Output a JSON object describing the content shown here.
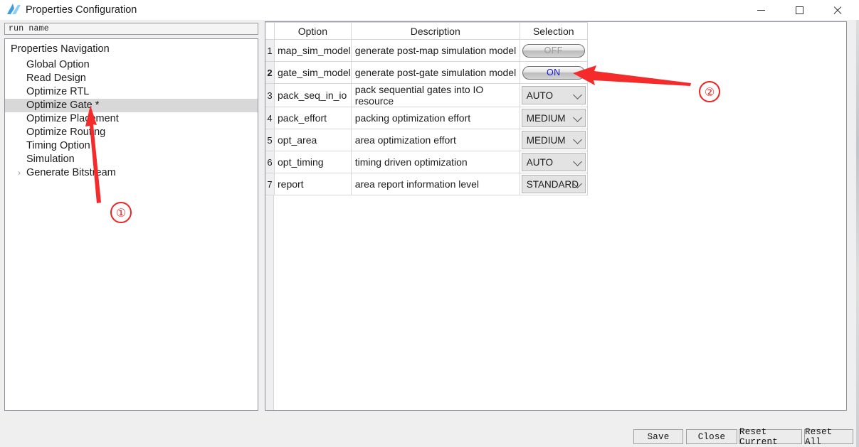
{
  "window": {
    "title": "Properties Configuration",
    "icon": "app-logo-icon",
    "minimize_label": "–",
    "maximize_label": "□",
    "close_label": "✕"
  },
  "run_name_field": {
    "value": "run name",
    "placeholder": "run name"
  },
  "navigation": {
    "root_label": "Properties Navigation",
    "items": [
      {
        "label": "Global Option",
        "selected": false,
        "expandable": false
      },
      {
        "label": "Read Design",
        "selected": false,
        "expandable": false
      },
      {
        "label": "Optimize RTL",
        "selected": false,
        "expandable": false
      },
      {
        "label": "Optimize Gate *",
        "selected": true,
        "expandable": false
      },
      {
        "label": "Optimize Placement",
        "selected": false,
        "expandable": false
      },
      {
        "label": "Optimize Routing",
        "selected": false,
        "expandable": false
      },
      {
        "label": "Timing Option",
        "selected": false,
        "expandable": false
      },
      {
        "label": "Simulation",
        "selected": false,
        "expandable": false
      },
      {
        "label": "Generate Bitstream",
        "selected": false,
        "expandable": true,
        "expander": "›"
      }
    ]
  },
  "table": {
    "columns": [
      "",
      "Option",
      "Description",
      "Selection"
    ],
    "rows": [
      {
        "num": "1",
        "option": "map_sim_model",
        "description": "generate post-map simulation model",
        "control": "toggle",
        "value": "OFF",
        "modified": false
      },
      {
        "num": "2",
        "option": "gate_sim_model",
        "description": "generate post-gate simulation model",
        "control": "toggle",
        "value": "ON",
        "modified": true
      },
      {
        "num": "3",
        "option": "pack_seq_in_io",
        "description": "pack sequential gates into IO resource",
        "control": "combo",
        "value": "AUTO",
        "modified": false
      },
      {
        "num": "4",
        "option": "pack_effort",
        "description": "packing optimization effort",
        "control": "combo",
        "value": "MEDIUM",
        "modified": false
      },
      {
        "num": "5",
        "option": "opt_area",
        "description": "area optimization effort",
        "control": "combo",
        "value": "MEDIUM",
        "modified": false
      },
      {
        "num": "6",
        "option": "opt_timing",
        "description": "timing driven optimization",
        "control": "combo",
        "value": "AUTO",
        "modified": false
      },
      {
        "num": "7",
        "option": "report",
        "description": "area report information level",
        "control": "combo",
        "value": "STANDARD",
        "modified": false
      }
    ]
  },
  "footer": {
    "buttons": [
      {
        "label": "Save"
      },
      {
        "label": "Close"
      },
      {
        "label": "Reset Current"
      },
      {
        "label": "Reset All"
      }
    ]
  },
  "annotations": {
    "color": "#ef2323",
    "markers": [
      {
        "label": "①",
        "target": "Optimize Gate *"
      },
      {
        "label": "②",
        "target": "gate_sim_model ON toggle"
      }
    ]
  }
}
